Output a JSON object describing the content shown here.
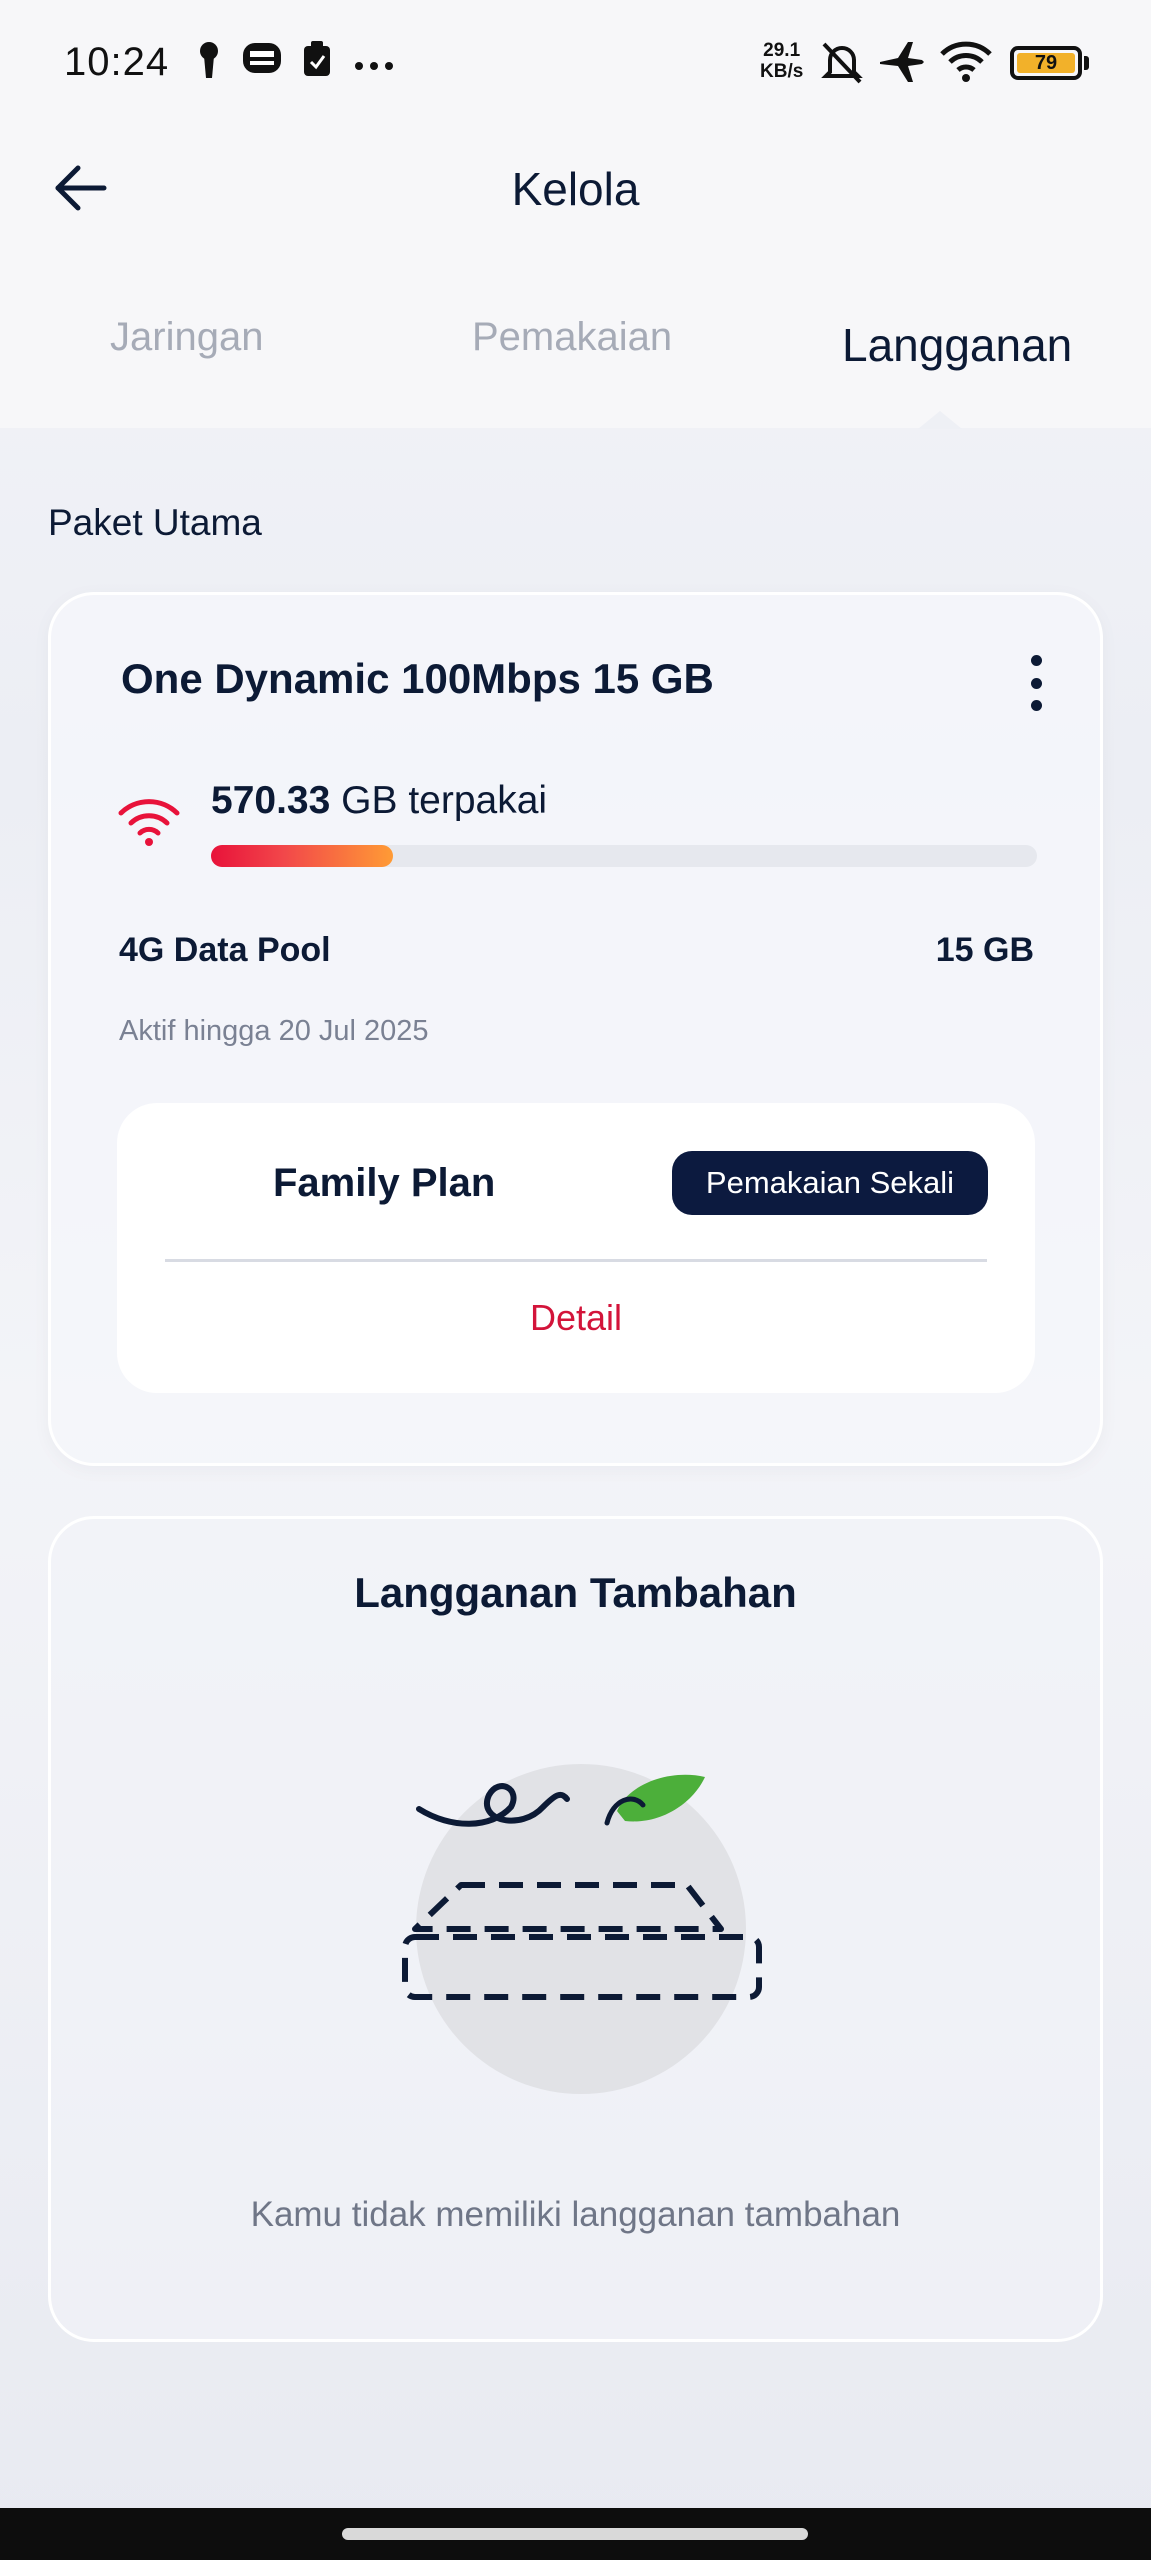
{
  "status_bar": {
    "time": "10:24",
    "net_rate_value": "29.1",
    "net_rate_unit": "KB/s",
    "battery_level": "79",
    "icons": [
      "keyhole-icon",
      "bus-icon",
      "clipboard-icon",
      "more-dots-icon",
      "bell-off-icon",
      "airplane-icon",
      "wifi-icon",
      "battery-icon"
    ],
    "battery_color": "#f2b12a"
  },
  "header": {
    "title": "Kelola",
    "back_icon": "arrow-left-icon"
  },
  "tabs": [
    {
      "label": "Jaringan",
      "active": false
    },
    {
      "label": "Pemakaian",
      "active": false
    },
    {
      "label": "Langganan",
      "active": true
    }
  ],
  "main": {
    "section_label": "Paket Utama",
    "plan": {
      "name": "One Dynamic 100Mbps 15 GB",
      "usage_value": "570.33",
      "usage_text": "GB terpakai",
      "usage_fraction": 0.22,
      "pool_label": "4G Data Pool",
      "pool_value": "15 GB",
      "active_until": "Aktif hingga 20 Jul 2025",
      "family": {
        "title": "Family Plan",
        "badge": "Pemakaian Sekali",
        "detail_link": "Detail"
      }
    },
    "addon": {
      "title": "Langganan Tambahan",
      "empty_text": "Kamu tidak memiliki langganan tambahan"
    }
  },
  "colors": {
    "primary_navy": "#0c1a35",
    "accent_red": "#d3143a",
    "progress_start": "#e8123a",
    "progress_end": "#ff9b35",
    "leaf_green": "#4caf3a"
  }
}
